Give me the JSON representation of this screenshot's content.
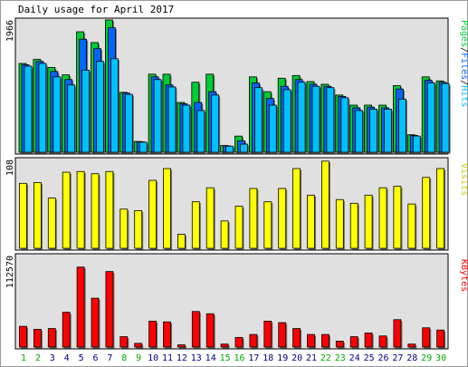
{
  "title": "Daily usage for April 2017",
  "colors": {
    "background": "#ffffff",
    "panel_bg": "#e0e0e0",
    "pages": "#00cc33",
    "files": "#0066ff",
    "hits": "#00c0ff",
    "visits": "#ffff00",
    "kbytes": "#ff0000",
    "weekend_label": "#00aa00",
    "weekday_label": "#000080"
  },
  "chart_data": [
    {
      "type": "bar",
      "title": "Daily usage for April 2017",
      "ylabel_parts": [
        "Pages",
        "Files",
        "Hits"
      ],
      "ymax_label": "1966",
      "ylim": [
        0,
        1966
      ],
      "categories": [
        "1",
        "2",
        "3",
        "4",
        "5",
        "6",
        "7",
        "8",
        "9",
        "10",
        "11",
        "12",
        "13",
        "14",
        "15",
        "16",
        "17",
        "18",
        "19",
        "20",
        "21",
        "22",
        "23",
        "24",
        "25",
        "26",
        "27",
        "28",
        "29",
        "30"
      ],
      "series": [
        {
          "name": "Pages",
          "values": [
            1320,
            1380,
            1260,
            1150,
            1790,
            1630,
            1966,
            890,
            160,
            1160,
            1160,
            740,
            1040,
            1160,
            100,
            240,
            1120,
            900,
            1100,
            1140,
            1050,
            1010,
            850,
            700,
            700,
            700,
            990,
            260,
            1120,
            1060
          ]
        },
        {
          "name": "Files",
          "values": [
            1300,
            1350,
            1200,
            1080,
            1680,
            1540,
            1850,
            880,
            155,
            1120,
            1000,
            720,
            740,
            900,
            95,
            170,
            1030,
            800,
            980,
            1080,
            1010,
            980,
            830,
            660,
            670,
            660,
            940,
            250,
            1070,
            1040
          ]
        },
        {
          "name": "Hits",
          "values": [
            1280,
            1320,
            1120,
            1000,
            1220,
            1350,
            1390,
            860,
            150,
            1080,
            970,
            700,
            620,
            850,
            90,
            120,
            960,
            700,
            930,
            1040,
            980,
            960,
            810,
            620,
            640,
            640,
            790,
            240,
            1030,
            1020
          ]
        }
      ]
    },
    {
      "type": "bar",
      "ylabel": "Visits",
      "ymax_label": "108",
      "ylim": [
        0,
        108
      ],
      "categories": [
        "1",
        "2",
        "3",
        "4",
        "5",
        "6",
        "7",
        "8",
        "9",
        "10",
        "11",
        "12",
        "13",
        "14",
        "15",
        "16",
        "17",
        "18",
        "19",
        "20",
        "21",
        "22",
        "23",
        "24",
        "25",
        "26",
        "27",
        "28",
        "29",
        "30"
      ],
      "series": [
        {
          "name": "Visits",
          "values": [
            88,
            89,
            68,
            103,
            104,
            101,
            104,
            53,
            51,
            92,
            108,
            19,
            63,
            82,
            37,
            57,
            81,
            63,
            81,
            108,
            72,
            118,
            66,
            61,
            72,
            82,
            84,
            60,
            96,
            108
          ]
        }
      ]
    },
    {
      "type": "bar",
      "ylabel": "KBytes",
      "ymax_label": "112570",
      "ylim": [
        0,
        112570
      ],
      "categories": [
        "1",
        "2",
        "3",
        "4",
        "5",
        "6",
        "7",
        "8",
        "9",
        "10",
        "11",
        "12",
        "13",
        "14",
        "15",
        "16",
        "17",
        "18",
        "19",
        "20",
        "21",
        "22",
        "23",
        "24",
        "25",
        "26",
        "27",
        "28",
        "29",
        "30"
      ],
      "series": [
        {
          "name": "KBytes",
          "values": [
            28000,
            24000,
            25000,
            47000,
            108000,
            66000,
            102000,
            14000,
            5000,
            35000,
            34000,
            3000,
            48000,
            45000,
            4000,
            13000,
            17000,
            35000,
            33000,
            25000,
            17000,
            17000,
            8000,
            14000,
            19000,
            15000,
            37000,
            4000,
            26000,
            23000
          ]
        }
      ]
    }
  ],
  "day_labels": [
    "1",
    "2",
    "3",
    "4",
    "5",
    "6",
    "7",
    "8",
    "9",
    "10",
    "11",
    "12",
    "13",
    "14",
    "15",
    "16",
    "17",
    "18",
    "19",
    "20",
    "21",
    "22",
    "23",
    "24",
    "25",
    "26",
    "27",
    "28",
    "29",
    "30"
  ],
  "weekend_days": [
    "1",
    "2",
    "8",
    "9",
    "15",
    "16",
    "22",
    "23",
    "29",
    "30"
  ]
}
